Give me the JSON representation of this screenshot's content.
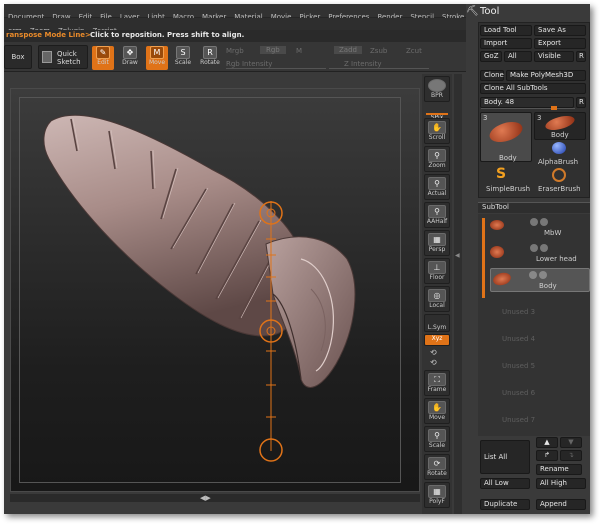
{
  "menu_row1": [
    "Document",
    "Draw",
    "Edit",
    "File",
    "Layer",
    "Light",
    "Macro",
    "Marker",
    "Material",
    "Movie",
    "Picker",
    "Preferences",
    "Render",
    "Stencil",
    "Stroke"
  ],
  "menu_row2": [
    "orm",
    "Zoom",
    "Zplugin",
    "Zscript"
  ],
  "mode": {
    "name": "ranspose Mode Line>",
    "hint": "Click to reposition. Press shift to align."
  },
  "toolbar": {
    "box": "Box",
    "quick_sketch_1": "Quick",
    "quick_sketch_2": "Sketch",
    "edit": "Edit",
    "draw": "Draw",
    "move": "Move",
    "scale": "Scale",
    "rotate": "Rotate",
    "mrgb": "Mrgb",
    "rgb": "Rgb",
    "m": "M",
    "zadd": "Zadd",
    "zsub": "Zsub",
    "zcut": "Zcut",
    "rgb_intensity": "Rgb Intensity",
    "z_intensity": "Z Intensity"
  },
  "shelf": [
    "BPR",
    "SPix",
    "Scroll",
    "Zoom",
    "Actual",
    "AAHalf",
    "Persp",
    "Floor",
    "Local",
    "L.Sym",
    "Xyz",
    "Frame",
    "Move",
    "Scale",
    "Rotate",
    "PolyF"
  ],
  "tool_panel": {
    "title": "Tool",
    "load_tool": "Load Tool",
    "save_as": "Save As",
    "import": "Import",
    "export": "Export",
    "goz": "GoZ",
    "all": "All",
    "visible": "Visible",
    "r": "R",
    "clone": "Clone",
    "make_polymesh": "Make PolyMesh3D",
    "clone_all": "Clone All SubTools",
    "body_label": "Body. 48",
    "body_value": 48,
    "body_r": "R",
    "brushes": [
      {
        "name": "Body",
        "num": "3"
      },
      {
        "name": "Body",
        "num": "3"
      },
      {
        "name": "AlphaBrush"
      },
      {
        "name": "SimpleBrush"
      },
      {
        "name": "EraserBrush"
      }
    ],
    "subtool_title": "SubTool",
    "subtools": [
      "MbW",
      "Lower head",
      "Body"
    ],
    "unused": [
      "Unused 3",
      "Unused 4",
      "Unused 5",
      "Unused 6",
      "Unused 7"
    ],
    "list_all": "List All",
    "rename": "Rename",
    "all_low": "All Low",
    "all_high": "All High",
    "duplicate": "Duplicate",
    "append": "Append"
  },
  "colors": {
    "accent": "#e07318",
    "panel": "#3a3a3a",
    "button": "#262626",
    "model": "#b49a98"
  }
}
